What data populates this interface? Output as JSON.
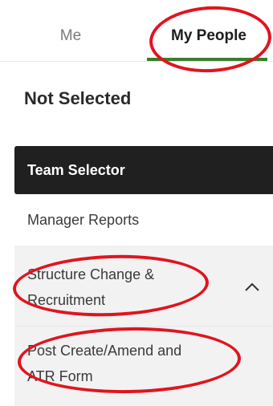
{
  "tabs": {
    "me_label": "Me",
    "people_label": "My People"
  },
  "header": {
    "not_selected": "Not Selected"
  },
  "menu": {
    "team_selector": "Team Selector",
    "manager_reports": "Manager Reports",
    "structure_change_line1": "Structure Change &",
    "structure_change_line2": "Recruitment",
    "post_create_line1": "Post Create/Amend and",
    "post_create_line2": "ATR Form"
  },
  "colors": {
    "accent_green": "#3a7d2c",
    "annotation_red": "#e1141e",
    "selector_dark": "#202020",
    "submenu_bg": "#f2f2f2"
  }
}
